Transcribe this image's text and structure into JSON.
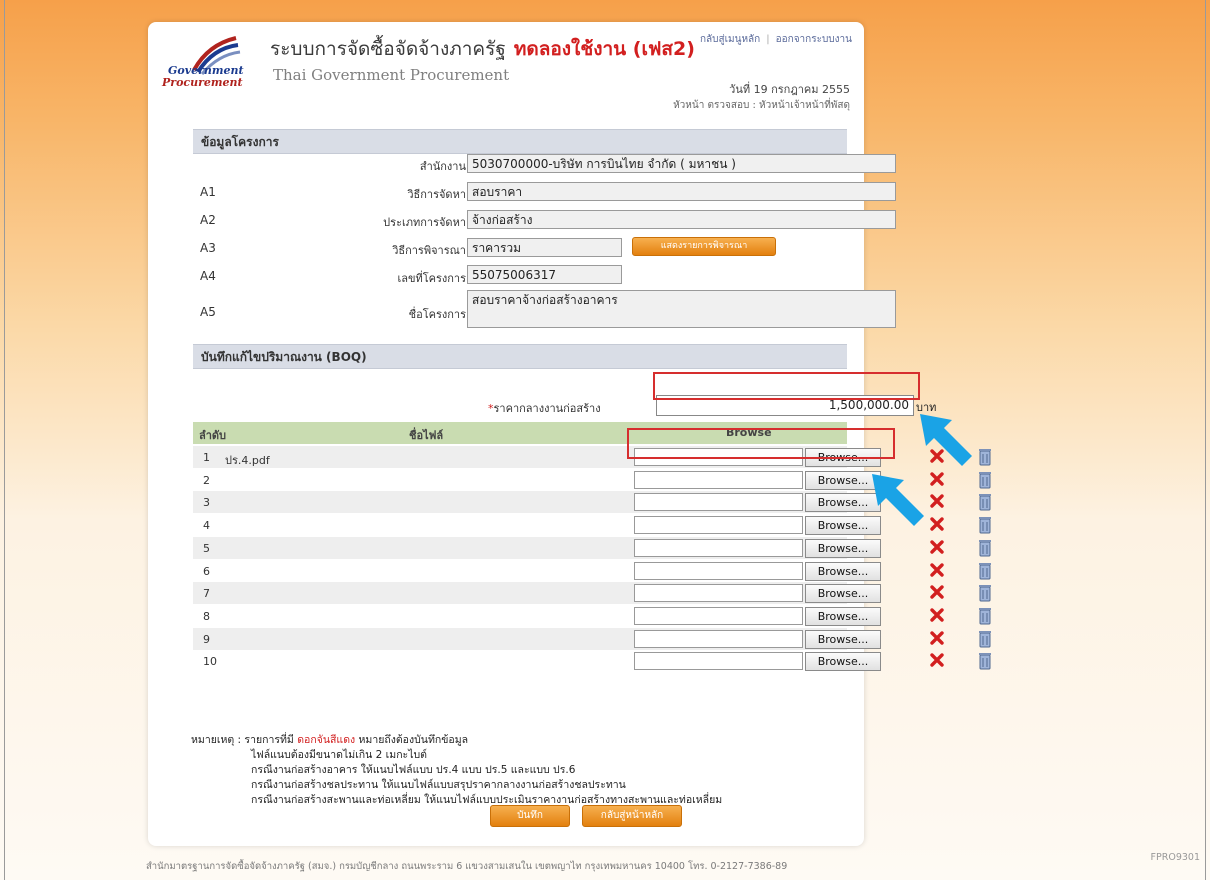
{
  "header": {
    "logo_line1": "Government",
    "logo_line2": "Procurement",
    "title": "ระบบการจัดซื้อจัดจ้างภาครัฐ",
    "trial_label": "ทดลองใช้งาน (เฟส2)",
    "subtitle": "Thai Government Procurement",
    "link_home": "กลับสู่เมนูหลัก",
    "link_logout": "ออกจากระบบงาน",
    "date": "วันที่ 19 กรกฎาคม 2555",
    "role": "หัวหน้า ตรวจสอบ : หัวหน้าเจ้าหน้าที่พัสดุ"
  },
  "project": {
    "section_title": "ข้อมูลโครงการ",
    "fields": [
      {
        "code": "",
        "label": "สำนักงาน",
        "value": "5030700000-บริษัท การบินไทย จำกัด ( มหาชน )"
      },
      {
        "code": "A1",
        "label": "วิธีการจัดหา",
        "value": "สอบราคา"
      },
      {
        "code": "A2",
        "label": "ประเภทการจัดหา",
        "value": "จ้างก่อสร้าง"
      },
      {
        "code": "A3",
        "label": "วิธีการพิจารณา",
        "value": "ราคารวม"
      },
      {
        "code": "A4",
        "label": "เลขที่โครงการ",
        "value": "55075006317"
      },
      {
        "code": "A5",
        "label": "ชื่อโครงการ",
        "value": "สอบราคาจ้างก่อสร้างอาคาร"
      }
    ],
    "consider_button": "แสดงรายการพิจารณา"
  },
  "boq": {
    "section_title": "บันทึกแก้ไขปริมาณงาน (BOQ)",
    "required_mark": "*",
    "price_label": "ราคากลางงานก่อสร้าง",
    "price_value": "1,500,000.00",
    "price_unit": "บาท",
    "col_no": "ลำดับ",
    "col_name": "ชื่อไฟล์",
    "col_browse": "Browse",
    "browse_label": "Browse...",
    "rows": [
      {
        "no": "1",
        "file": "ปร.4.pdf"
      },
      {
        "no": "2",
        "file": ""
      },
      {
        "no": "3",
        "file": ""
      },
      {
        "no": "4",
        "file": ""
      },
      {
        "no": "5",
        "file": ""
      },
      {
        "no": "6",
        "file": ""
      },
      {
        "no": "7",
        "file": ""
      },
      {
        "no": "8",
        "file": ""
      },
      {
        "no": "9",
        "file": ""
      },
      {
        "no": "10",
        "file": ""
      }
    ]
  },
  "notes": {
    "prefix": "หมายเหตุ : รายการที่มี",
    "red_text": "ดอกจันสีแดง",
    "suffix": "หมายถึงต้องบันทึกข้อมูล",
    "lines": [
      "ไฟล์แนบต้องมีขนาดไม่เกิน 2 เมกะไบต์",
      "กรณีงานก่อสร้างอาคาร ให้แนบไฟล์แบบ ปร.4 แบบ ปร.5 และแบบ ปร.6",
      "กรณีงานก่อสร้างชลประทาน ให้แนบไฟล์แบบสรุปราคากลางงานก่อสร้างชลประทาน",
      "กรณีงานก่อสร้างสะพานและท่อเหลี่ยม ให้แนบไฟล์แบบประเมินราคางานก่อสร้างทางสะพานและท่อเหลี่ยม"
    ]
  },
  "actions": {
    "save": "บันทึก",
    "back": "กลับสู่หน้าหลัก"
  },
  "footer": {
    "text": "สำนักมาตรฐานการจัดซื้อจัดจ้างภาครัฐ (สมจ.) กรมบัญชีกลาง ถนนพระราม 6 แขวงสามเสนใน เขตพญาไท กรุงเทพมหานคร 10400 โทร. 0-2127-7386-89",
    "code": "FPRO9301"
  },
  "colors": {
    "accent_orange": "#e3800e",
    "trial_red": "#d21f1f",
    "section_bg": "#d9dde6",
    "table_head_bg": "#c9dcb1",
    "arrow_blue": "#1aa3e6"
  }
}
